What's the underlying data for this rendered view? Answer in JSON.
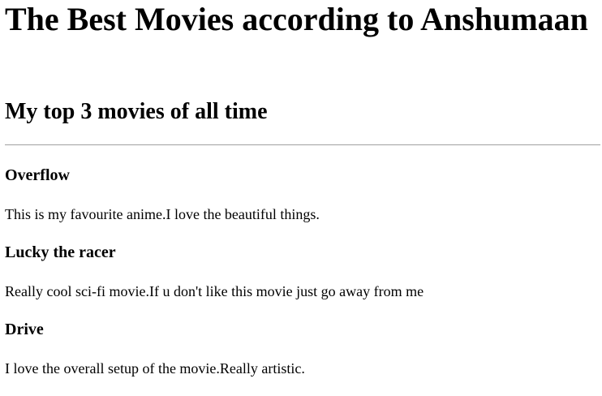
{
  "page": {
    "heading": "The Best Movies according to Anshumaan",
    "subheading": "My top 3 movies of all time"
  },
  "movies": [
    {
      "title": "Overflow",
      "description": "This is my favourite anime.I love the beautiful things."
    },
    {
      "title": "Lucky the racer",
      "description": "Really cool sci-fi movie.If u don't like this movie just go away from me"
    },
    {
      "title": "Drive",
      "description": "I love the overall setup of the movie.Really artistic."
    }
  ]
}
